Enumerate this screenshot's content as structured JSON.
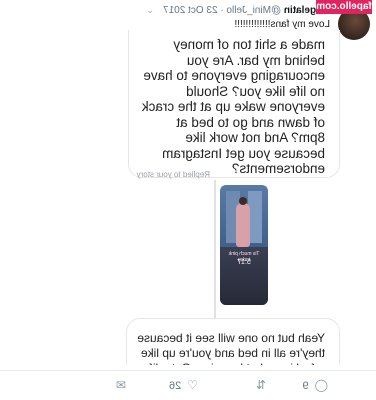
{
  "watermark": "fapello.com",
  "tweet": {
    "display_name": "all gelatin",
    "handle": "@Mini_Jello",
    "date": "· 23 Oct 2017",
    "text": "Love my fans!!!!!!!!!!!!!"
  },
  "dm": {
    "message1": "made a shit ton of money behind my bar. Are you encouraging everyone to have no life like you? Should everyone wake up at the crack of dawn and go to bed at 8pm? And not work like because you get Instagram endorsements?",
    "replied_label": "Replied to your story",
    "story_caption": "Tis much pink today",
    "story_time": "5:17",
    "message2": "Yeah but no one will see it because they're all in bed and you're up like a fucking robot lemming. Get a life for"
  },
  "actions": {
    "reply_count": "9",
    "retweet_count": "",
    "like_count": "26",
    "icons": [
      "reply-icon",
      "retweet-icon",
      "like-icon",
      "message-icon"
    ]
  },
  "colors": {
    "watermark_bg": "#e0245e",
    "muted": "#657786"
  }
}
